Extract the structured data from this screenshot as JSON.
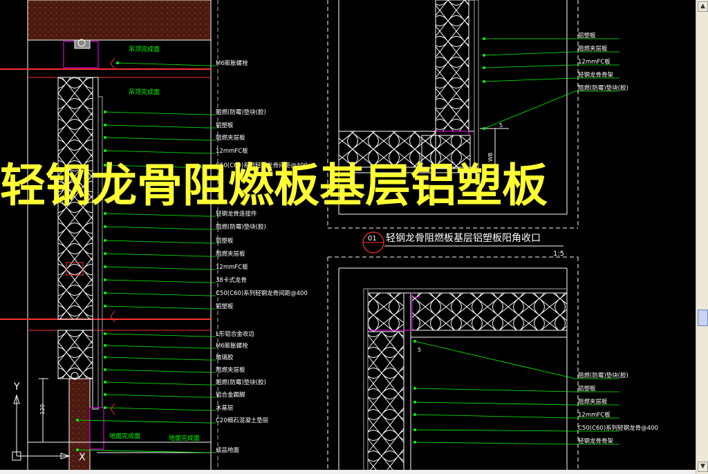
{
  "overlay_title": "轻钢龙骨阻燃板基层铝塑板",
  "detail": {
    "number": "01",
    "title": "轻钢龙骨阻燃板基层铝塑板阳角收口",
    "scale": "1:5"
  },
  "left_labels": [
    "M6膨胀螺栓",
    "阻燃(防霉)垫块(胶)",
    "铝塑板",
    "阻燃夹层板",
    "12mmFC板",
    "C50(C60)系列轻钢龙骨间距@400",
    "轻钢龙骨连接件",
    "阻燃(防霉)垫块(胶)",
    "铝塑板",
    "阻燃夹层板",
    "12mmFC板",
    "38卡式龙骨",
    "C50(C60)系列轻钢龙骨间距@400",
    "铝塑板",
    "L形铝合金收边",
    "M6膨胀螺栓",
    "玻璃胶",
    "阻燃夹层板",
    "阻燃(防霉)垫块(胶)",
    "铝合金踢脚",
    "木基层",
    "C20细石混凝土垫层",
    "成品地面"
  ],
  "right_top_labels": [
    "铝塑板",
    "阻燃夹层板",
    "12mmFC板",
    "轻钢龙骨骨架",
    "阻燃(防霉)垫块(胶)"
  ],
  "right_bottom_labels": [
    "阻燃(防霉)垫块(胶)",
    "铝塑板",
    "阻燃夹层板",
    "12mmFC板",
    "C50(C60)系列轻钢龙骨@400",
    "轻钢龙骨骨架"
  ],
  "small_labels": {
    "ceiling_a": "吊顶完成面",
    "ceiling_b": "吊顶完成面",
    "floor_a": "地面完成面",
    "floor_b": "地面完成面",
    "dim_a": "120",
    "dim_b": "WB",
    "dim_c": "5",
    "dim_d": "5"
  },
  "ucs": {
    "y": "Y",
    "x": "X"
  },
  "colors": {
    "background": "#000000",
    "leader": "#00ff00",
    "outline": "#ffffff",
    "insulation": "#ffffff",
    "red_line": "#ff3030",
    "magenta": "#ff00ff",
    "overlay": "#ffff33",
    "concrete": "#5a1c12"
  }
}
